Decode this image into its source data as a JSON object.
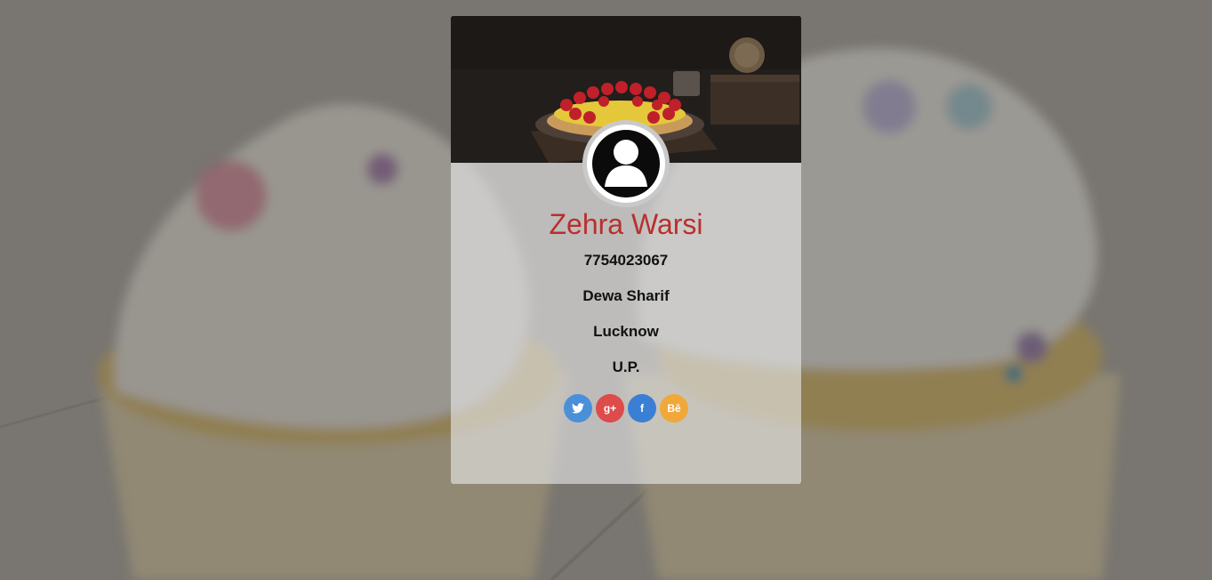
{
  "profile": {
    "name": "Zehra Warsi",
    "phone": "7754023067",
    "area": "Dewa Sharif",
    "city": "Lucknow",
    "state": "U.P."
  },
  "social": [
    {
      "name": "twitter",
      "icon": "twitter-icon",
      "glyph": "🐦",
      "color": "#4a90d9"
    },
    {
      "name": "google-plus",
      "icon": "google-plus-icon",
      "glyph": "g+",
      "color": "#dd4b4b"
    },
    {
      "name": "facebook",
      "icon": "facebook-icon",
      "glyph": "f",
      "color": "#3b7fd4"
    },
    {
      "name": "behance",
      "icon": "behance-icon",
      "glyph": "Bē",
      "color": "#f0a83a"
    }
  ],
  "colors": {
    "name": "#b8302d",
    "card_overlay": "#e8e8e8"
  }
}
